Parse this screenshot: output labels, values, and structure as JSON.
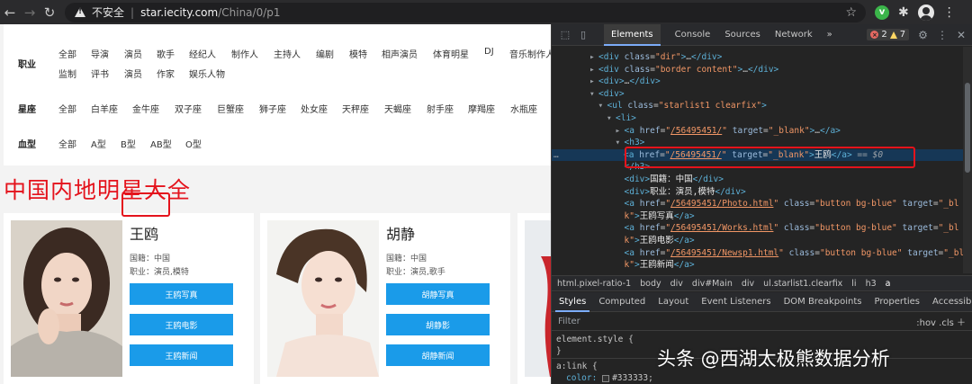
{
  "browser": {
    "insecure_label": "不安全",
    "separator": "|",
    "url_host": "star.iecity.com",
    "url_path": "/China/0/p1",
    "ext_v_label": "v"
  },
  "filters": {
    "occupation": {
      "label": "职业",
      "row1": [
        "全部",
        "导演",
        "演员",
        "歌手",
        "经纪人",
        "制作人",
        "主持人",
        "编剧",
        "模特",
        "相声演员",
        "体育明星",
        "DJ",
        "音乐制作人"
      ],
      "row2": [
        "监制",
        "评书",
        "演员",
        "作家",
        "娱乐人物"
      ]
    },
    "zodiac": {
      "label": "星座",
      "options": [
        "全部",
        "白羊座",
        "金牛座",
        "双子座",
        "巨蟹座",
        "狮子座",
        "处女座",
        "天秤座",
        "天蝎座",
        "射手座",
        "摩羯座",
        "水瓶座"
      ]
    },
    "blood": {
      "label": "血型",
      "options": [
        "全部",
        "A型",
        "B型",
        "AB型",
        "O型"
      ]
    }
  },
  "heading": "中国内地明星大全",
  "cards": [
    {
      "name": "王鸥",
      "nationality": "国籍：中国",
      "occupation": "职业：演员,模特",
      "buttons": [
        "王鸥写真",
        "王鸥电影",
        "王鸥新闻"
      ]
    },
    {
      "name": "胡静",
      "nationality": "国籍：中国",
      "occupation": "职业：演员,歌手",
      "buttons": [
        "胡静写真",
        "胡静影",
        "胡静新闻"
      ]
    }
  ],
  "devtools": {
    "tabs": [
      "Elements",
      "Console",
      "Sources",
      "Network"
    ],
    "more": "»",
    "errors": "2",
    "warnings": "7",
    "dom_lines": [
      {
        "indent": 0,
        "html": "<span class='tri'>▸</span><span class='tag'>&lt;div</span> <span class='an'>class</span>=<span class='av'>\"dir\"</span><span class='tag'>&gt;</span>…<span class='tag'>&lt;/div&gt;</span>"
      },
      {
        "indent": 0,
        "html": "<span class='tri'>▸</span><span class='tag'>&lt;div</span> <span class='an'>class</span>=<span class='av'>\"border content\"</span><span class='tag'>&gt;</span>…<span class='tag'>&lt;/div&gt;</span>"
      },
      {
        "indent": 0,
        "html": "<span class='tri'>▸</span><span class='tag'>&lt;div&gt;</span>…<span class='tag'>&lt;/div&gt;</span>"
      },
      {
        "indent": 0,
        "html": "<span class='tri'>▾</span><span class='tag'>&lt;div&gt;</span>"
      },
      {
        "indent": 1,
        "html": "<span class='tri'>▾</span><span class='tag'>&lt;ul</span> <span class='an'>class</span>=<span class='av'>\"starlist1 clearfix\"</span><span class='tag'>&gt;</span>"
      },
      {
        "indent": 2,
        "html": "<span class='tri'>▾</span><span class='tag'>&lt;li&gt;</span>"
      },
      {
        "indent": 3,
        "html": "<span class='tri'>▸</span><span class='tag'>&lt;a</span> <span class='an'>href</span>=<span class='av'>\"<u>/56495451/</u>\"</span> <span class='an'>target</span>=<span class='av'>\"_blank\"</span><span class='tag'>&gt;</span>…<span class='tag'>&lt;/a&gt;</span>"
      },
      {
        "indent": 3,
        "html": "<span class='tri'>▾</span><span class='tag'>&lt;h3&gt;</span>"
      },
      {
        "indent": 4,
        "sel": true,
        "html": "<span class='tag'>&lt;a</span> <span class='an'>href</span>=<span class='av'>\"<u>/56495451/</u>\"</span> <span class='an'>target</span>=<span class='av'>\"_blank\"</span><span class='tag'>&gt;</span><span class='tx'>王鸥</span><span class='tag'>&lt;/a&gt;</span> <span class='dim'>==</span> <span class='dollar'>$0</span>"
      },
      {
        "indent": 3,
        "html": "<span class='tri'></span><span class='tag'>&lt;/h3&gt;</span>"
      },
      {
        "indent": 3,
        "html": "<span class='tri'></span><span class='tag'>&lt;div&gt;</span><span class='tx'>国籍：中国</span><span class='tag'>&lt;/div&gt;</span>"
      },
      {
        "indent": 3,
        "html": "<span class='tri'></span><span class='tag'>&lt;div&gt;</span><span class='tx'>职业：演员,模特</span><span class='tag'>&lt;/div&gt;</span>"
      },
      {
        "indent": 3,
        "html": "<span class='tri'></span><span class='tag'>&lt;a</span> <span class='an'>href</span>=<span class='av'>\"<u>/56495451/Photo.html</u>\"</span> <span class='an'>class</span>=<span class='av'>\"button bg-blue\"</span> <span class='an'>target</span>=<span class='av'>\"_bl</span>"
      },
      {
        "indent": 3,
        "html": "<span class='tri'></span><span class='av'>k\"</span><span class='tag'>&gt;</span><span class='tx'>王鸥写真</span><span class='tag'>&lt;/a&gt;</span>"
      },
      {
        "indent": 3,
        "html": "<span class='tri'></span><span class='tag'>&lt;a</span> <span class='an'>href</span>=<span class='av'>\"<u>/56495451/Works.html</u>\"</span> <span class='an'>class</span>=<span class='av'>\"button bg-blue\"</span> <span class='an'>target</span>=<span class='av'>\"_bl</span>"
      },
      {
        "indent": 3,
        "html": "<span class='tri'></span><span class='av'>k\"</span><span class='tag'>&gt;</span><span class='tx'>王鸥电影</span><span class='tag'>&lt;/a&gt;</span>"
      },
      {
        "indent": 3,
        "html": "<span class='tri'></span><span class='tag'>&lt;a</span> <span class='an'>href</span>=<span class='av'>\"<u>/56495451/Newsp1.html</u>\"</span> <span class='an'>class</span>=<span class='av'>\"button bg-blue\"</span> <span class='an'>target</span>=<span class='av'>\"_bl</span>"
      },
      {
        "indent": 3,
        "html": "<span class='tri'></span><span class='av'>k\"</span><span class='tag'>&gt;</span><span class='tx'>王鸥新闻</span><span class='tag'>&lt;/a&gt;</span>"
      }
    ],
    "breadcrumbs": [
      "html.pixel-ratio-1",
      "body",
      "div",
      "div#Main",
      "div",
      "ul.starlist1.clearfix",
      "li",
      "h3",
      "a"
    ],
    "sub_tabs": [
      "Styles",
      "Computed",
      "Layout",
      "Event Listeners",
      "DOM Breakpoints",
      "Properties",
      "Accessibility"
    ],
    "filter_placeholder": "Filter",
    "filter_right": ":hov .cls ＋",
    "styles_lines": [
      "element.style {",
      "}",
      "a:link {",
      "color:",
      "#333333;"
    ]
  },
  "watermark": "头条 @西湖太极熊数据分析"
}
